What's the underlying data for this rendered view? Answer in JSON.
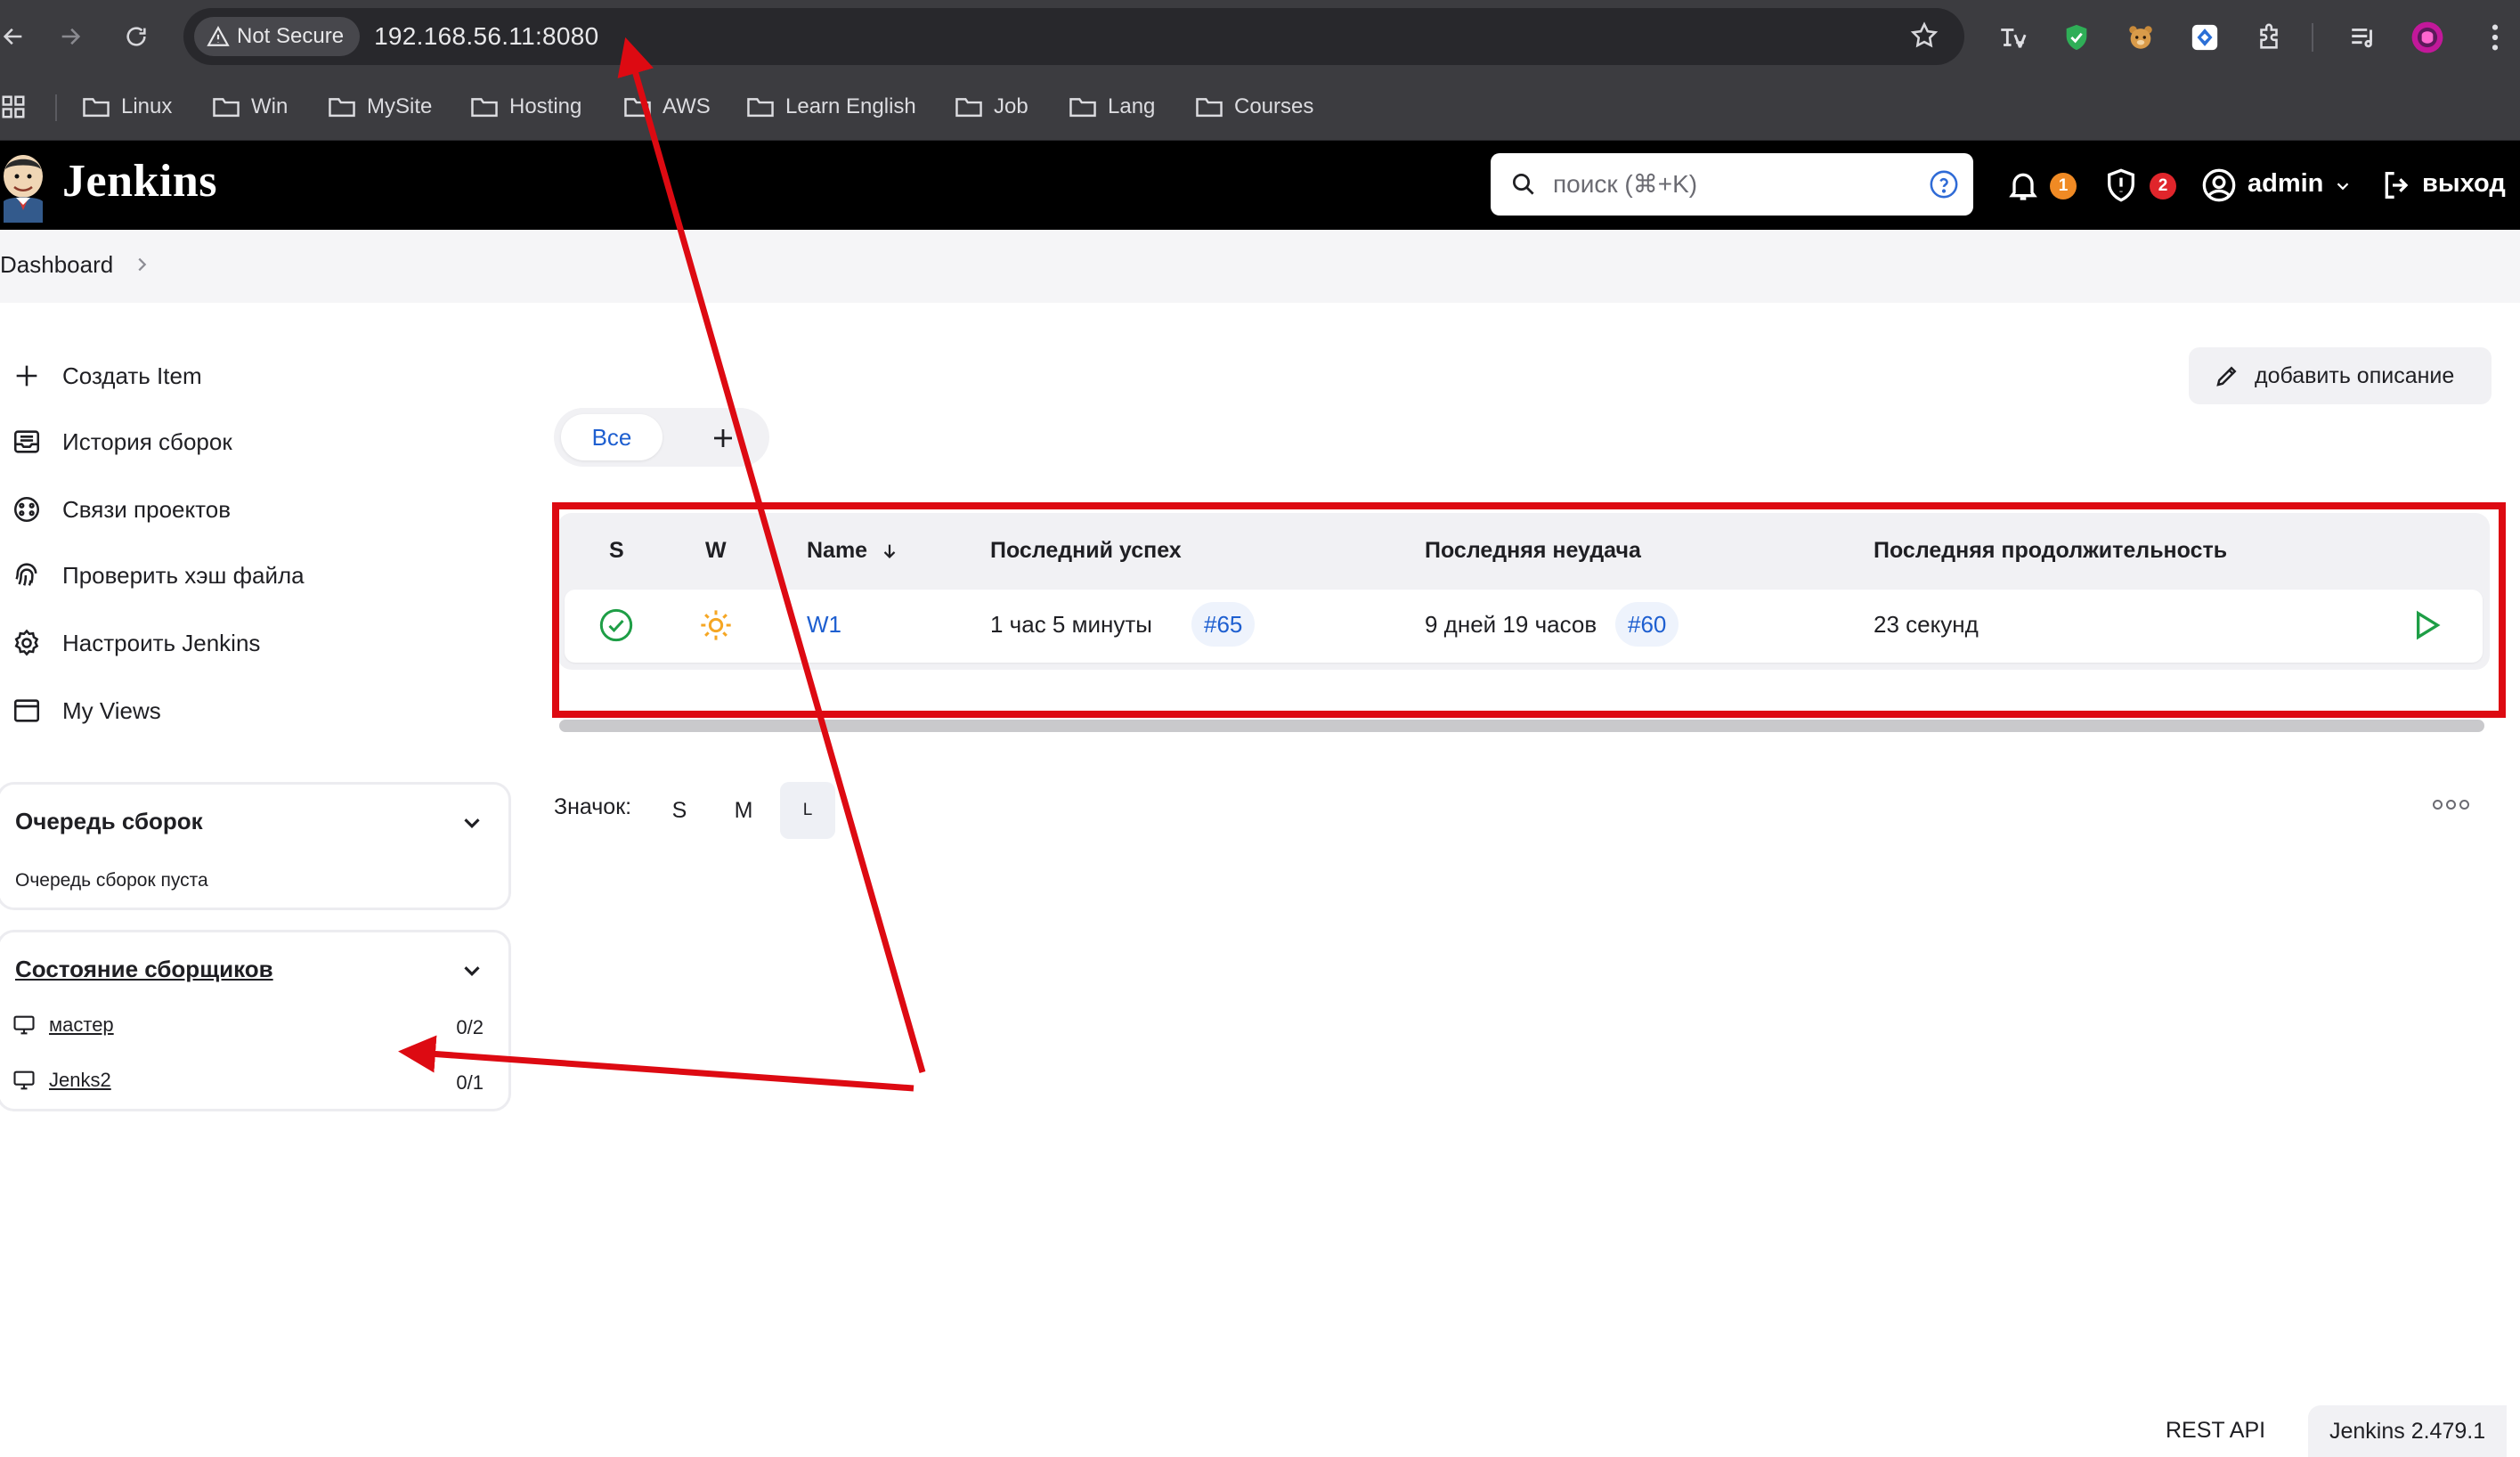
{
  "browser": {
    "not_secure_label": "Not Secure",
    "url": "192.168.56.11:8080",
    "bookmarks": [
      "Linux",
      "Win",
      "MySite",
      "Hosting",
      "AWS",
      "Learn English",
      "Job",
      "Lang",
      "Courses"
    ]
  },
  "header": {
    "brand": "Jenkins",
    "search_placeholder": "поиск (⌘+K)",
    "notifications_count": "1",
    "security_count": "2",
    "user": "admin",
    "logout": "выход"
  },
  "breadcrumb": {
    "home": "Dashboard"
  },
  "sidebar": {
    "items": [
      {
        "label": "Создать Item",
        "icon": "plus-icon"
      },
      {
        "label": "История сборок",
        "icon": "inbox-icon"
      },
      {
        "label": "Связи проектов",
        "icon": "relations-icon"
      },
      {
        "label": "Проверить хэш файла",
        "icon": "fingerprint-icon"
      },
      {
        "label": "Настроить Jenkins",
        "icon": "gear-icon"
      },
      {
        "label": "My Views",
        "icon": "window-icon"
      }
    ],
    "queue": {
      "title": "Очередь сборок",
      "empty_text": "Очередь сборок пуста"
    },
    "executors": {
      "title": "Состояние сборщиков",
      "agents": [
        {
          "name": "мастер",
          "count": "0/2"
        },
        {
          "name": "Jenks2",
          "count": "0/1"
        }
      ]
    }
  },
  "main": {
    "add_description": "добавить описание",
    "tabs": {
      "all": "Все"
    },
    "table": {
      "headers": {
        "s": "S",
        "w": "W",
        "name": "Name",
        "last_success": "Последний успех",
        "last_failure": "Последняя неудача",
        "last_duration": "Последняя продолжительность"
      },
      "rows": [
        {
          "status": "success",
          "weather": "sunny",
          "name": "W1",
          "last_success": "1 час 5 минуты",
          "last_success_build": "#65",
          "last_failure": "9 дней 19 часов",
          "last_failure_build": "#60",
          "last_duration": "23 секунд"
        }
      ]
    },
    "icon_size": {
      "label": "Значок:",
      "options": [
        "S",
        "M",
        "L"
      ],
      "selected": "L"
    }
  },
  "footer": {
    "rest_api": "REST API",
    "version": "Jenkins 2.479.1"
  },
  "colors": {
    "annotation": "#dd0a12",
    "link": "#1e5fd0",
    "success": "#1e9e46",
    "sunny": "#f5a623",
    "badge_orange": "#f08a24",
    "badge_red": "#e0252b"
  }
}
